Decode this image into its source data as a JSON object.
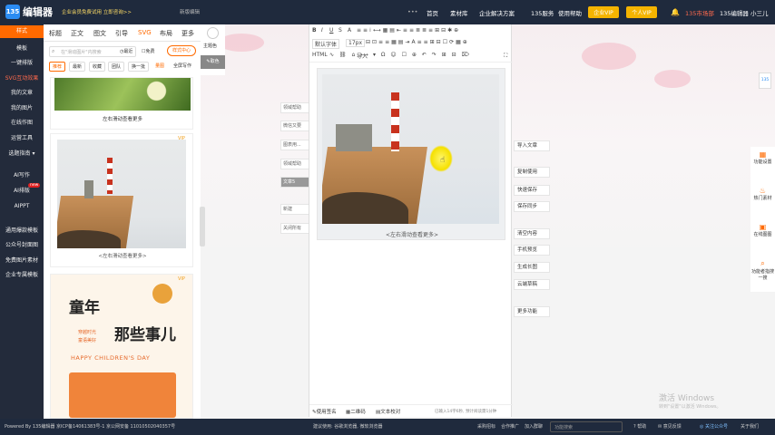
{
  "topbar": {
    "logo_badge": "135",
    "logo_text": "编辑器",
    "notice": "企业会员免费试用 立即咨询>>",
    "new_version": "新版编辑",
    "nav": [
      "首页",
      "素材库",
      "企业解决方案",
      "135服务",
      "使用帮助"
    ],
    "enterprise_vip": "企业VIP",
    "personal_vip": "个人VIP",
    "store": "135市场部",
    "user": "135编辑器 小三儿"
  },
  "left_nav": {
    "active": "样式",
    "items": [
      "模板",
      "一键排版",
      "SVG互动效果",
      "我的文章",
      "我的图片",
      "在线作图",
      "运营工具",
      "选题指南"
    ],
    "ai_items": [
      "AI写作",
      "AI排版",
      "AIPPT"
    ],
    "new_badge": "new",
    "extra_items": [
      "通用爆款模板",
      "公众号封面图",
      "免费图片素材",
      "企业专属模板"
    ]
  },
  "panel": {
    "tabs": [
      "标题",
      "正文",
      "图文",
      "引导",
      "SVG",
      "布局",
      "更多"
    ],
    "search_placeholder": "在\"滑动图片\"内搜索",
    "recent": "最近",
    "free": "免费",
    "style_center": "样式中心",
    "chips": [
      "推荐",
      "最新",
      "收藏",
      "团队",
      "换一批",
      "量图",
      "全屏写作"
    ],
    "caption1": "左右滑动查看更多",
    "vip1": "VIP",
    "caption2": "<左右滑动查看更多>",
    "vip2": "VIP",
    "children_title1": "童年",
    "children_title2": "那些事儿",
    "children_sub1": "穿越时光",
    "children_sub2": "童语美好",
    "children_en": "HAPPY CHILDREN'S DAY"
  },
  "side_tools": {
    "theme": "主题色",
    "color": "取色"
  },
  "editor": {
    "font": "默认字体",
    "size": "17px",
    "import": "导入",
    "caption": "<左右滑动查看更多>",
    "footer": [
      "使用签名",
      "二维码",
      "文本校对"
    ],
    "count": "已输入14字6秒, 预计阅读需1分钟"
  },
  "ghost_buttons": [
    "领域帮助",
    "微信又要",
    "图表用...",
    "领域帮助",
    "文章5",
    "新建",
    "关闭所有"
  ],
  "right_actions": [
    "导入文章",
    "复制使用",
    "快速保存",
    "保存同步",
    "清空内容",
    "手机预览",
    "生成长图",
    "云端草稿",
    "更多功能"
  ],
  "right_tools": [
    "功能设置",
    "热门素材",
    "在线图图",
    "功能者指搜一搜"
  ],
  "watermark": {
    "line1": "激活 Windows",
    "line2": "转到\"设置\"以激活 Windows。"
  },
  "bottombar": {
    "left": "Powered By 135编辑器  京ICP备14061383号-1  京公网安备 11010502040357号",
    "mid": "建议使用: 谷歌浏览器, 微软浏览器",
    "links": [
      "采购招标",
      "合作推广",
      "加入群聊"
    ],
    "search_placeholder": "功能搜索",
    "help": "帮助",
    "feedback": "意见反馈",
    "follow": "关注公众号",
    "about": "关于我们"
  }
}
